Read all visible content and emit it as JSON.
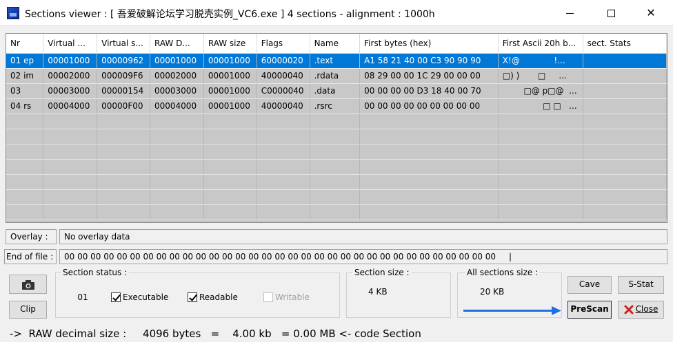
{
  "window": {
    "title": "Sections viewer :  [ 吾爱破解论坛学习脱壳实例_VC6.exe ] 4 sections - alignment : 1000h",
    "close_glyph": "✕"
  },
  "grid": {
    "columns": [
      "Nr",
      "Virtual ...",
      "Virtual s...",
      "RAW D...",
      "RAW size",
      "Flags",
      "Name",
      "First bytes (hex)",
      "First Ascii 20h b...",
      "sect. Stats"
    ],
    "rows": [
      [
        "01 ep",
        "00001000",
        "00000962",
        "00001000",
        "00001000",
        "60000020",
        ".text",
        "A1 58 21 40 00 C3 90 90 90",
        "X!@             !...",
        ""
      ],
      [
        "02 im",
        "00002000",
        "000009F6",
        "00002000",
        "00001000",
        "40000040",
        ".rdata",
        "08 29 00 00 1C 29 00 00 00",
        "□) )       □     ...",
        ""
      ],
      [
        "03",
        "00003000",
        "00000154",
        "00003000",
        "00001000",
        "C0000040",
        ".data",
        "00 00 00 00 D3 18 40 00 70",
        "□@ p□@  ...",
        ""
      ],
      [
        "04 rs",
        "00004000",
        "00000F00",
        "00004000",
        "00001000",
        "40000040",
        ".rsrc",
        "00 00 00 00 00 00 00 00 00",
        "□ □   ...",
        ""
      ]
    ]
  },
  "overlay": {
    "label": "Overlay :",
    "value": "No overlay data"
  },
  "eof": {
    "label": "End of file :",
    "value": "00 00 00 00 00 00 00 00 00 00 00 00 00 00 00 00 00 00 00 00 00 00 00 00 00 00 00 00 00 00 00 00 00     |"
  },
  "buttons": {
    "clip": "Clip",
    "cave": "Cave",
    "sstat": "S-Stat",
    "prescan": "PreScan",
    "close": "Close"
  },
  "section_status": {
    "title": "Section status :",
    "index": "01",
    "executable": "Executable",
    "readable": "Readable",
    "writable": "Writable"
  },
  "section_size": {
    "title": "Section size :",
    "value": "4 KB"
  },
  "all_sections_size": {
    "title": "All sections size :",
    "value": "20 KB"
  },
  "status_bar": "->  RAW decimal size :     4096 bytes   =    4.00 kb   = 0.00 MB <- code Section",
  "colors": {
    "selection": "#0078d7",
    "grid_bg": "#c8c8c8",
    "arrow": "#1e6fe0",
    "close_x": "#cc1f1f"
  }
}
